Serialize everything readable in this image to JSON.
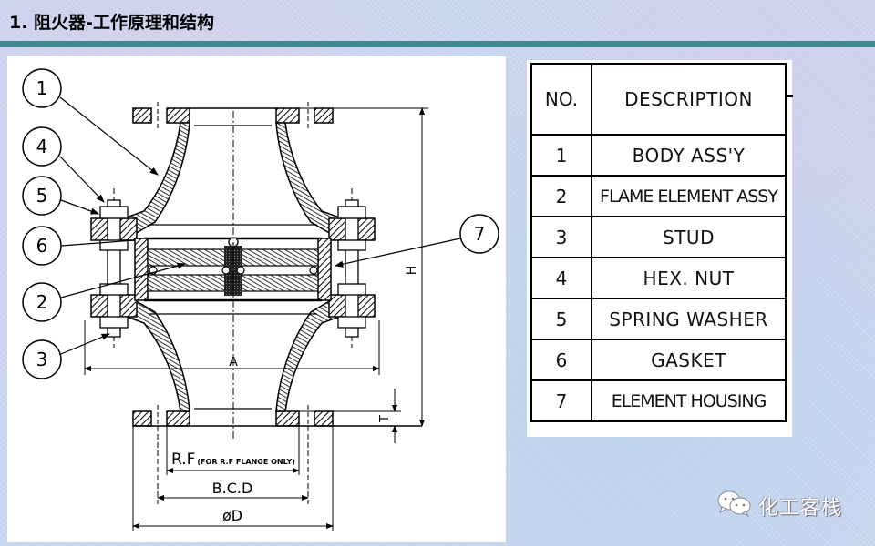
{
  "slide": {
    "title": "1. 阻火器-工作原理和结构",
    "accent_color": "#3e8a90"
  },
  "drawing": {
    "callouts": [
      "1",
      "4",
      "5",
      "6",
      "2",
      "3",
      "7"
    ],
    "dimension_labels": {
      "height": "H",
      "width": "A",
      "flange_thickness": "T",
      "raised_face": "R.F",
      "raised_face_note": "(FOR R.F FLANGE ONLY)",
      "bolt_circle": "B.C.D",
      "outer_diameter": "øD"
    }
  },
  "parts_table": {
    "headers": [
      "NO.",
      "DESCRIPTION"
    ],
    "rows": [
      {
        "no": "1",
        "description": "BODY ASS'Y"
      },
      {
        "no": "2",
        "description": "FLAME ELEMENT ASSY"
      },
      {
        "no": "3",
        "description": "STUD"
      },
      {
        "no": "4",
        "description": "HEX. NUT"
      },
      {
        "no": "5",
        "description": "SPRING WASHER"
      },
      {
        "no": "6",
        "description": "GASKET"
      },
      {
        "no": "7",
        "description": "ELEMENT HOUSING"
      }
    ]
  },
  "watermark": {
    "icon": "wechat-icon",
    "text": "化工客栈"
  }
}
